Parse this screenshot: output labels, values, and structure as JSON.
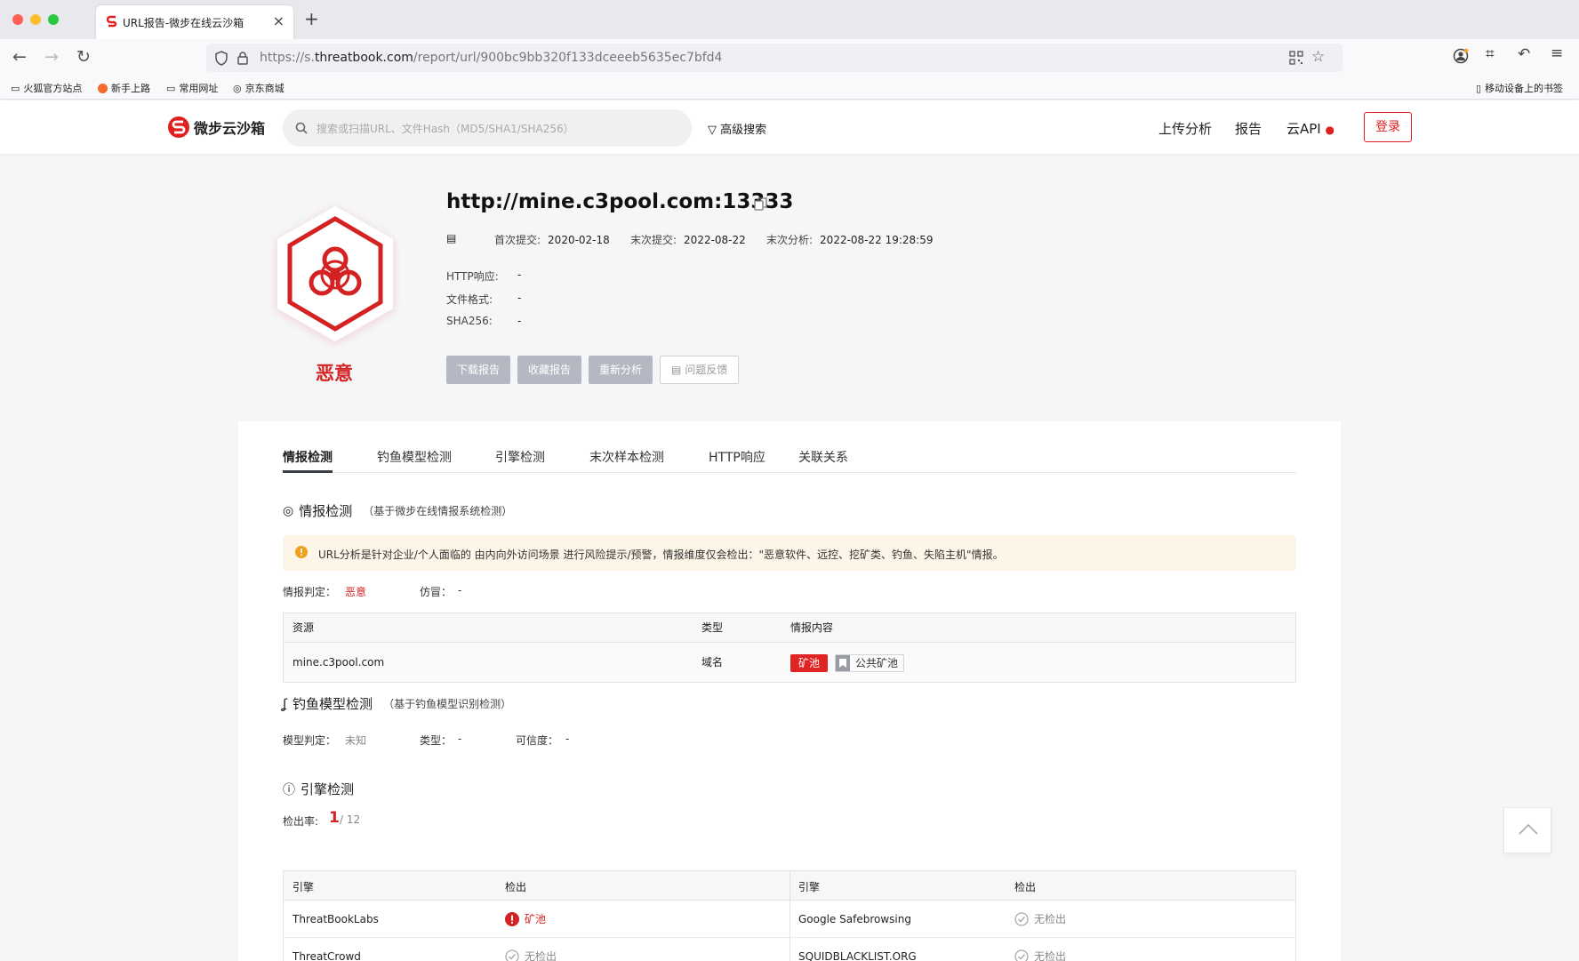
{
  "browser": {
    "tab_title": "URL报告-微步在线云沙箱",
    "url_prefix": "https://s.",
    "url_domain": "threatbook.com",
    "url_path": "/report/url/900bc9bb320f133dceeeb5635ec7bfd4",
    "bookmarks": [
      "火狐官方站点",
      "新手上路",
      "常用网址",
      "京东商城"
    ],
    "mobile_bookmarks": "移动设备上的书签"
  },
  "header": {
    "logo_text": "微步云沙箱",
    "search_placeholder": "搜索或扫描URL、文件Hash（MD5/SHA1/SHA256）",
    "advanced_search": "高级搜索",
    "nav": [
      "上传分析",
      "报告",
      "云API"
    ],
    "login": "登录"
  },
  "summary": {
    "verdict": "恶意",
    "url": "http://mine.c3pool.com:13333",
    "first_submit_label": "首次提交:",
    "first_submit": "2020-02-18",
    "last_submit_label": "末次提交:",
    "last_submit": "2022-08-22",
    "last_analysis_label": "末次分析:",
    "last_analysis": "2022-08-22 19:28:59",
    "http_label": "HTTP响应:",
    "http_value": "-",
    "format_label": "文件格式:",
    "format_value": "-",
    "sha256_label": "SHA256:",
    "sha256_value": "-",
    "buttons": [
      "下载报告",
      "收藏报告",
      "重新分析",
      "问题反馈"
    ]
  },
  "tabs": [
    "情报检测",
    "钓鱼模型检测",
    "引擎检测",
    "末次样本检测",
    "HTTP响应",
    "关联关系"
  ],
  "intel": {
    "title": "情报检测",
    "subtitle": "（基于微步在线情报系统检测）",
    "notice": "URL分析是针对企业/个人面临的 由内向外访问场景 进行风险提示/预警，情报维度仅会检出：\"恶意软件、远控、挖矿类、钓鱼、失陷主机\"情报。",
    "verdict_label": "情报判定：",
    "verdict_value": "恶意",
    "impersonate_label": "仿冒：",
    "impersonate_value": "-",
    "columns": [
      "资源",
      "类型",
      "情报内容"
    ],
    "row": {
      "resource": "mine.c3pool.com",
      "type": "域名",
      "tag": "矿池",
      "tag2": "公共矿池"
    }
  },
  "phish": {
    "title": "钓鱼模型检测",
    "subtitle": "（基于钓鱼模型识别检测）",
    "model_label": "模型判定：",
    "model_value": "未知",
    "type_label": "类型：",
    "type_value": "-",
    "conf_label": "可信度：",
    "conf_value": "-"
  },
  "engine": {
    "title": "引擎检测",
    "rate_label": "检出率:",
    "detected": "1",
    "total": "/ 12",
    "columns": [
      "引擎",
      "检出",
      "引擎",
      "检出"
    ],
    "rows": [
      {
        "e1": "ThreatBookLabs",
        "r1": "矿池",
        "e2": "Google Safebrowsing",
        "r2": "无检出"
      },
      {
        "e1": "ThreatCrowd",
        "r1": "无检出",
        "e2": "SQUIDBLACKLIST.ORG",
        "r2": "无检出"
      }
    ]
  },
  "colors": {
    "accent": "#e02020",
    "verdict": "#d42222"
  }
}
